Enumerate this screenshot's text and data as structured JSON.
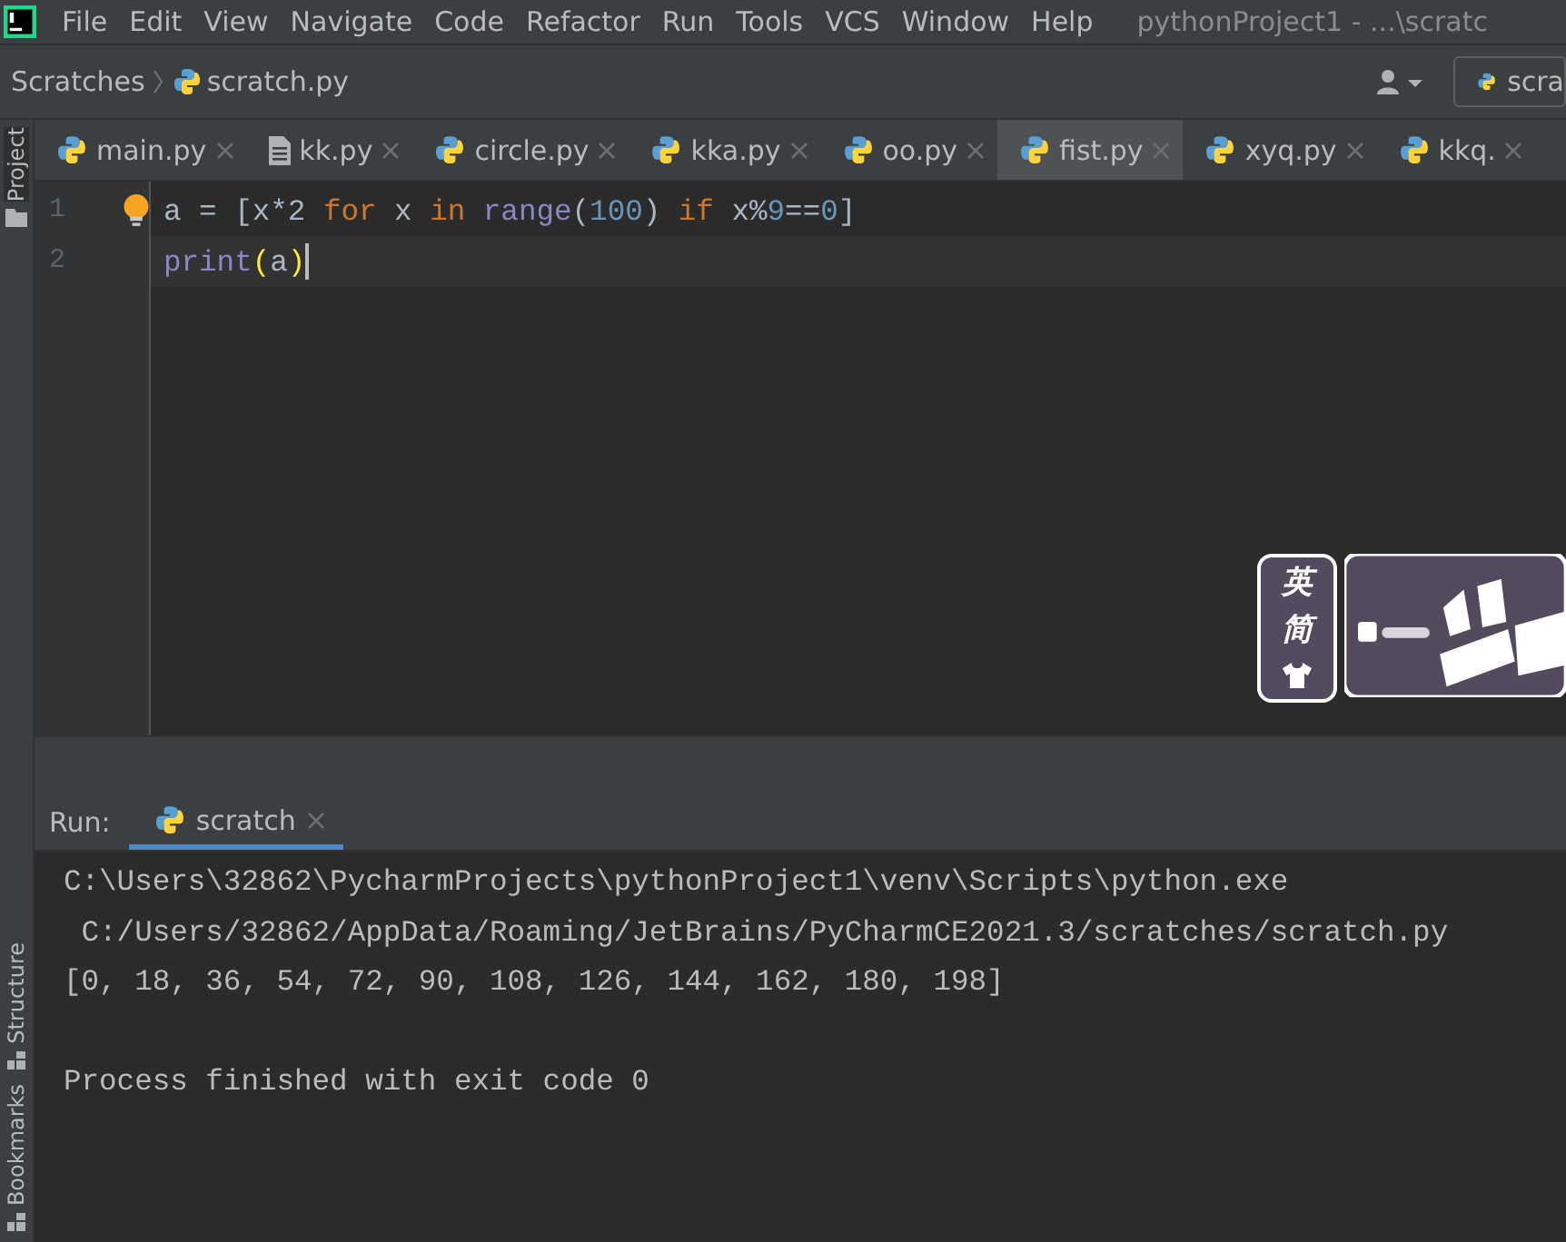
{
  "menu_bar": {
    "items": [
      "File",
      "Edit",
      "View",
      "Navigate",
      "Code",
      "Refactor",
      "Run",
      "Tools",
      "VCS",
      "Window",
      "Help"
    ],
    "title": "pythonProject1 - ...\\scratc"
  },
  "breadcrumb": {
    "items": [
      "Scratches",
      "scratch.py"
    ],
    "run_config": "scra"
  },
  "left_strip": {
    "top": [
      "Project"
    ],
    "bottom": [
      "Structure",
      "Bookmarks"
    ]
  },
  "tabs": [
    {
      "label": "main.py",
      "kind": "python",
      "selected": false
    },
    {
      "label": "kk.py",
      "kind": "text",
      "selected": false
    },
    {
      "label": "circle.py",
      "kind": "python",
      "selected": false
    },
    {
      "label": "kka.py",
      "kind": "python",
      "selected": false
    },
    {
      "label": "oo.py",
      "kind": "python",
      "selected": false
    },
    {
      "label": "fist.py",
      "kind": "python",
      "selected": true
    },
    {
      "label": "xyq.py",
      "kind": "python",
      "selected": false
    },
    {
      "label": "kkq.",
      "kind": "python",
      "selected": false
    }
  ],
  "editor": {
    "lines": [
      {
        "number": "1",
        "current": false,
        "tokens": [
          {
            "text": "a",
            "kind": "plain"
          },
          {
            "text": " = ",
            "kind": "plain"
          },
          {
            "text": "[x*2 ",
            "kind": "plain"
          },
          {
            "text": "for ",
            "kind": "keyword"
          },
          {
            "text": "x ",
            "kind": "plain"
          },
          {
            "text": "in ",
            "kind": "keyword"
          },
          {
            "text": "range",
            "kind": "builtin"
          },
          {
            "text": "(",
            "kind": "plain"
          },
          {
            "text": "100",
            "kind": "number"
          },
          {
            "text": ") ",
            "kind": "plain"
          },
          {
            "text": "if ",
            "kind": "keyword"
          },
          {
            "text": "x%",
            "kind": "plain"
          },
          {
            "text": "9",
            "kind": "number"
          },
          {
            "text": "==",
            "kind": "plain"
          },
          {
            "text": "0",
            "kind": "number"
          },
          {
            "text": "]",
            "kind": "plain"
          }
        ]
      },
      {
        "number": "2",
        "current": true,
        "tokens": [
          {
            "text": "print",
            "kind": "builtin"
          },
          {
            "text": "(",
            "kind": "brace"
          },
          {
            "text": "a",
            "kind": "plain"
          },
          {
            "text": ")",
            "kind": "brace"
          }
        ]
      }
    ]
  },
  "ime_toolbar": {
    "labels": [
      "英",
      "简"
    ]
  },
  "run_panel": {
    "label": "Run:",
    "tab": "scratch",
    "output": [
      "C:\\Users\\32862\\PycharmProjects\\pythonProject1\\venv\\Scripts\\python.exe",
      " C:/Users/32862/AppData/Roaming/JetBrains/PyCharmCE2021.3/scratches/scratch.py",
      "[0, 18, 36, 54, 72, 90, 108, 126, 144, 162, 180, 198]"
    ],
    "exit_message": "Process finished with exit code 0"
  }
}
